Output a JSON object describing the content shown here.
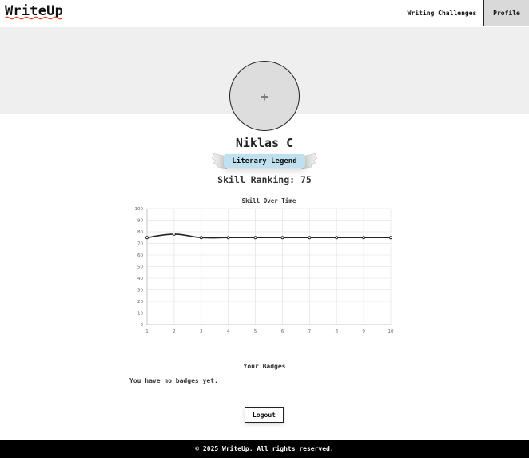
{
  "nav": {
    "logo": "WriteUp",
    "challenges_label": "Writing Challenges",
    "profile_label": "Profile"
  },
  "profile": {
    "avatar_placeholder": "+",
    "name": "Niklas C",
    "rank_title": "Literary Legend",
    "skill_ranking": "Skill Ranking: 75"
  },
  "chart_data": {
    "type": "line",
    "title": "Skill Over Time",
    "x": [
      1,
      2,
      3,
      4,
      5,
      6,
      7,
      8,
      9,
      10
    ],
    "values": [
      75,
      78,
      75,
      75,
      75,
      75,
      75,
      75,
      75,
      75
    ],
    "xlabel": "",
    "ylabel": "",
    "ylim": [
      0,
      100
    ],
    "yticks": [
      0,
      10,
      20,
      30,
      40,
      50,
      60,
      70,
      80,
      90,
      100
    ],
    "grid": true,
    "line_color": "#222222"
  },
  "badges": {
    "heading": "Your Badges",
    "empty_text": "You have no badges yet."
  },
  "actions": {
    "logout_label": "Logout"
  },
  "footer": {
    "text": "© 2025 WriteUp. All rights reserved."
  },
  "colors": {
    "rank_badge": "#bfe0ee",
    "active_nav": "#d9d9d9",
    "banner": "#efefef"
  }
}
